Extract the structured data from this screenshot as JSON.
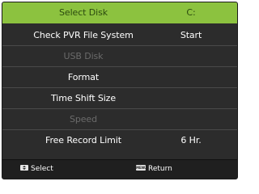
{
  "menu": {
    "items": [
      {
        "label": "Select Disk",
        "value": "C:",
        "state": "selected"
      },
      {
        "label": "Check PVR File System",
        "value": "Start",
        "state": "normal"
      },
      {
        "label": "USB Disk",
        "value": "",
        "state": "disabled"
      },
      {
        "label": "Format",
        "value": "",
        "state": "normal"
      },
      {
        "label": "Time Shift Size",
        "value": "",
        "state": "normal"
      },
      {
        "label": "Speed",
        "value": "",
        "state": "disabled"
      },
      {
        "label": "Free Record Limit",
        "value": "6 Hr.",
        "state": "normal"
      }
    ]
  },
  "footer": {
    "select_label": "Select",
    "select_icon": "up-down-key-icon",
    "return_label": "Return",
    "return_icon": "menu-key-icon"
  },
  "colors": {
    "selected_row": "#8cc23f",
    "panel_background": "#2c2c2c",
    "disabled_text": "#6b6b6b"
  }
}
